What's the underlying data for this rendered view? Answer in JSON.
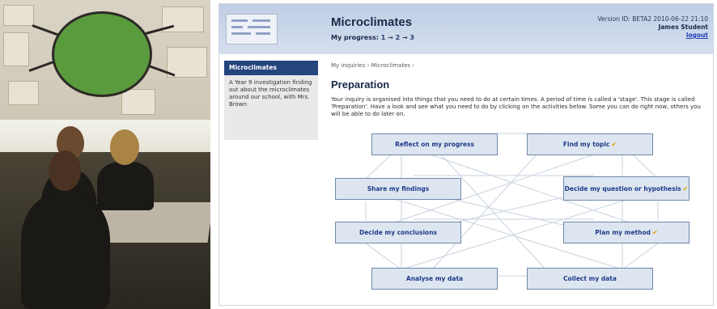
{
  "app": {
    "title": "Microclimates",
    "progress_label": "My progress:",
    "progress_steps": "1 → 2 → 3",
    "version": "Version ID: BETA2 2010-06-22 21:10",
    "user": "James Student",
    "logout": "logout"
  },
  "sidebar": {
    "title": "Microclimates",
    "description": "A Year 9 investigation finding out about the microclimates around our school, with Mrs. Brown"
  },
  "breadcrumb": {
    "item1": "My inquiries",
    "sep": " › ",
    "item2": "Microclimates",
    "trail": " ›"
  },
  "page": {
    "heading": "Preparation",
    "intro": "Your inquiry is organised into things that you need to do at certain times. A period of time is called a 'stage'. This stage is called 'Preparation'. Have a look and see what you need to do by clicking on the activities below. Some you can do right now, others you will be able to do later on."
  },
  "activities": {
    "reflect": "Reflect on my progress",
    "topic": "Find my topic",
    "share": "Share my findings",
    "question": "Decide my question or hypothesis",
    "conclusions": "Decide my conclusions",
    "method": "Plan my method",
    "analyse": "Analyse my data",
    "collect": "Collect my data",
    "tick": "✔"
  },
  "colors": {
    "header_bg": "#c8d5ea",
    "sidebar_title_bg": "#26447e",
    "activity_bg": "#dde6f0",
    "activity_text": "#1f3a8a",
    "tick": "#e0a000"
  }
}
